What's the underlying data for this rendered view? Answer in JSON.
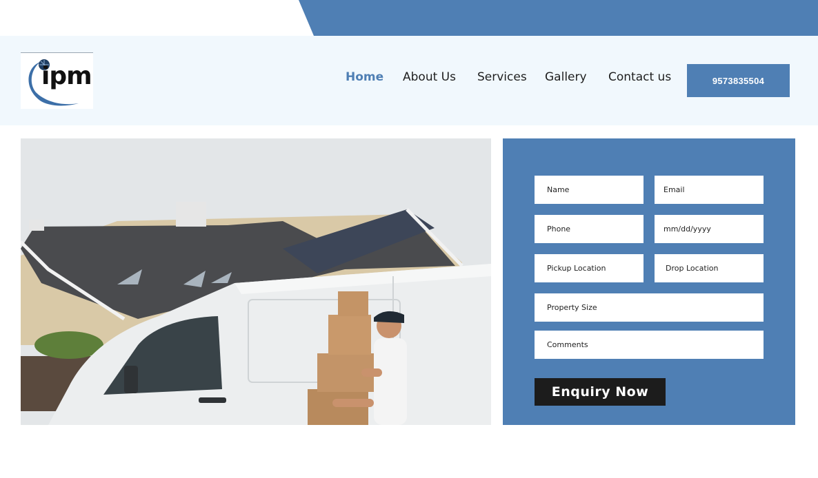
{
  "brand": {
    "logo_text": "ipm",
    "accent_color": "#4f7fb4",
    "header_bg": "#f1f8fd",
    "logo_icon": "globe-swoosh-icon"
  },
  "nav": {
    "items": [
      {
        "label": "Home",
        "active": true
      },
      {
        "label": "About Us",
        "active": false
      },
      {
        "label": "Services",
        "active": false
      },
      {
        "label": "Gallery",
        "active": false
      },
      {
        "label": "Contact us",
        "active": false
      }
    ],
    "phone_label": "9573835504"
  },
  "hero": {
    "image_semantic": "mover-carrying-boxes-beside-white-van-in-front-of-house"
  },
  "form": {
    "name_placeholder": "Name",
    "email_placeholder": "Email",
    "phone_placeholder": "Phone",
    "date_placeholder": "mm/dd/yyyy",
    "pickup_placeholder": "Pickup Location",
    "drop_placeholder": "Drop Location",
    "property_placeholder": "Property Size",
    "comments_placeholder": "Comments",
    "submit_label": "Enquiry Now"
  }
}
